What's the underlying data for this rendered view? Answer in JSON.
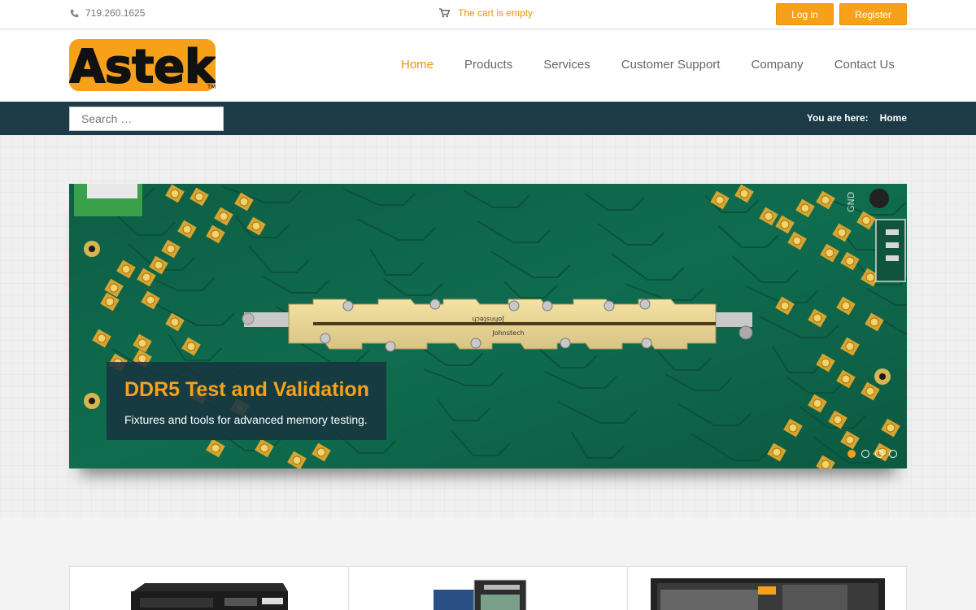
{
  "topbar": {
    "phone": "719.260.1625",
    "phone_icon": "phone-icon",
    "cart_text": "The cart is empty",
    "cart_icon": "cart-icon",
    "login_label": "Log in",
    "register_label": "Register"
  },
  "header": {
    "logo_text": "Astek",
    "logo_mark": "TM",
    "nav": [
      {
        "label": "Home",
        "active": true
      },
      {
        "label": "Products",
        "active": false
      },
      {
        "label": "Services",
        "active": false
      },
      {
        "label": "Customer Support",
        "active": false
      },
      {
        "label": "Company",
        "active": false
      },
      {
        "label": "Contact Us",
        "active": false
      }
    ]
  },
  "strip": {
    "search_placeholder": "Search …",
    "breadcrumb_label": "You are here:",
    "breadcrumb_current": "Home"
  },
  "slider": {
    "title": "DDR5 Test and Validation",
    "subtitle": "Fixtures and tools for advanced memory testing.",
    "slide_count": 4,
    "active_slide": 1,
    "board_labels": {
      "connector_top": "Johnstech",
      "connector_bottom": "Johnstech",
      "gnd": "GND"
    }
  },
  "colors": {
    "accent": "#f7a11a",
    "accent_text": "#e8920e",
    "strip_bg": "#1d3a47",
    "pcb_green": "#0f6a4e"
  }
}
